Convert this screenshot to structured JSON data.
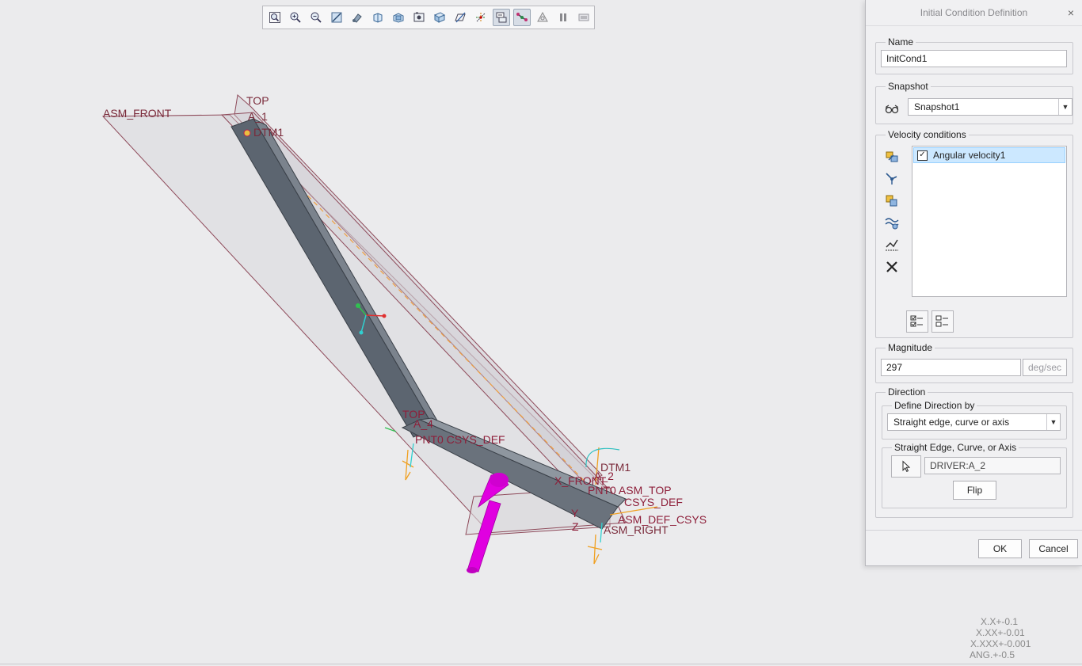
{
  "toolbar": {
    "tools": [
      {
        "icon": "refit-icon"
      },
      {
        "icon": "zoom-in-icon"
      },
      {
        "icon": "zoom-out-icon"
      },
      {
        "icon": "repaint-icon"
      },
      {
        "icon": "display-style-icon"
      },
      {
        "icon": "saved-orientations-icon"
      },
      {
        "icon": "view-manager-icon"
      },
      {
        "icon": "perspective-icon"
      },
      {
        "icon": "section-icon"
      },
      {
        "icon": "datum-display-filter-icon"
      },
      {
        "icon": "spin-center-icon"
      },
      {
        "icon": "annotation-display-icon",
        "active": true
      },
      {
        "icon": "mechanism-display-icon",
        "active": true
      },
      {
        "icon": "run-icon"
      },
      {
        "icon": "pause-icon"
      },
      {
        "icon": "stop-icon"
      }
    ]
  },
  "viewport": {
    "labels": {
      "asm_front": "ASM_FRONT",
      "top1": "TOP",
      "a1": "A_1",
      "dtm1_top": "DTM1",
      "top2": "TOP",
      "a4": "A_4",
      "pnt_csys": "PNT0 CSYS_DEF",
      "dtm1": "DTM1",
      "a2": "A_2",
      "pnt0_asm_top": "PNT0 ASM_TOP",
      "csys_def2": "CSYS_DEF",
      "asm_def_csys": "ASM_DEF_CSYS",
      "asm_right": "ASM_RIGHT",
      "x_axis": "X",
      "y_axis": "Y",
      "z_axis": "Z",
      "x_front": "X_FRONT"
    },
    "tolerances": [
      "X.X+-0.1",
      "X.XX+-0.01",
      "X.XXX+-0.001",
      "ANG.+-0.5"
    ]
  },
  "dialog": {
    "title": "Initial Condition Definition",
    "close_glyph": "×",
    "name": {
      "legend": "Name",
      "value": "InitCond1"
    },
    "snapshot": {
      "legend": "Snapshot",
      "selected": "Snapshot1"
    },
    "velocity": {
      "legend": "Velocity conditions",
      "items": [
        {
          "label": "Angular velocity1",
          "checked": true
        }
      ]
    },
    "magnitude": {
      "legend": "Magnitude",
      "value": "297",
      "unit": "deg/sec"
    },
    "direction": {
      "legend": "Direction",
      "define_by_legend": "Define Direction by",
      "define_by_selected": "Straight edge, curve or axis",
      "edge_legend": "Straight Edge, Curve, or Axis",
      "edge_value": "DRIVER:A_2",
      "flip_label": "Flip"
    },
    "ok_label": "OK",
    "cancel_label": "Cancel"
  },
  "colors": {
    "accent_magenta": "#e000e0",
    "datum_label": "#8e1f3a",
    "selection_blue": "#cce8ff"
  }
}
